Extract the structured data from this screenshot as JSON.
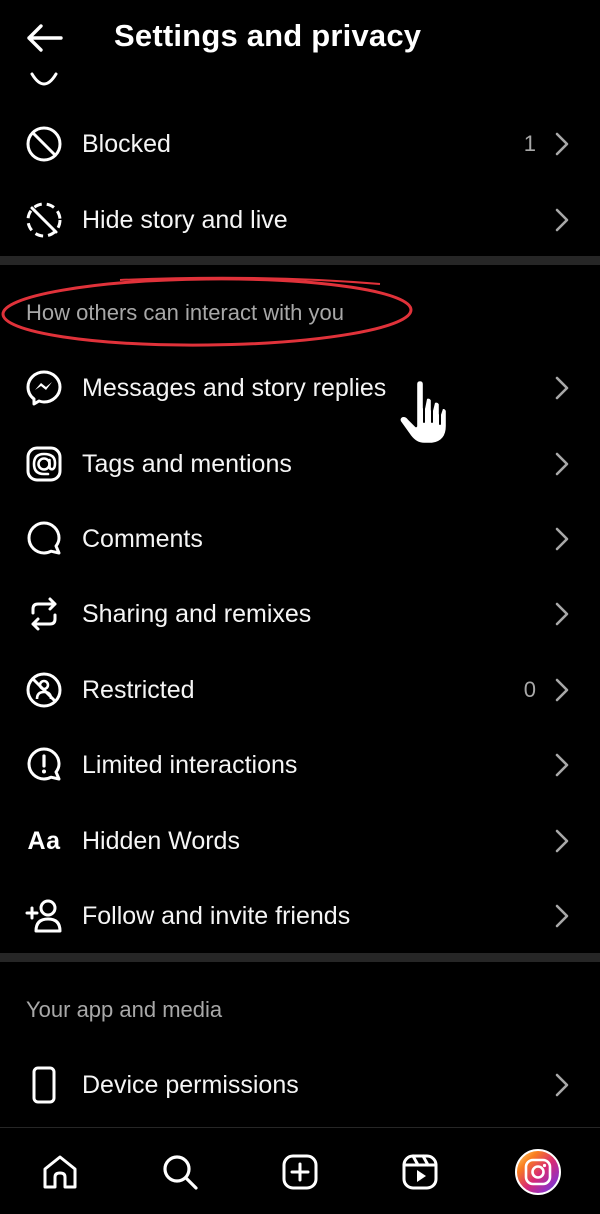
{
  "header": {
    "title": "Settings and privacy"
  },
  "rows_top": [
    {
      "label": "Blocked",
      "count": "1",
      "icon": "blocked-icon"
    },
    {
      "label": "Hide story and live",
      "count": "",
      "icon": "hide-story-icon"
    }
  ],
  "section_interact": {
    "title": "How others can interact with you",
    "items": [
      {
        "label": "Messages and story replies",
        "count": "",
        "icon": "messenger-icon"
      },
      {
        "label": "Tags and mentions",
        "count": "",
        "icon": "at-sign-icon"
      },
      {
        "label": "Comments",
        "count": "",
        "icon": "comment-icon"
      },
      {
        "label": "Sharing and remixes",
        "count": "",
        "icon": "share-remix-icon"
      },
      {
        "label": "Restricted",
        "count": "0",
        "icon": "restricted-icon"
      },
      {
        "label": "Limited interactions",
        "count": "",
        "icon": "limited-interactions-icon"
      },
      {
        "label": "Hidden Words",
        "count": "",
        "icon": "hidden-words-icon",
        "glyph": "Aa"
      },
      {
        "label": "Follow and invite friends",
        "count": "",
        "icon": "add-person-icon"
      }
    ]
  },
  "section_app": {
    "title": "Your app and media",
    "items": [
      {
        "label": "Device permissions",
        "count": "",
        "icon": "phone-icon"
      }
    ]
  },
  "nav": [
    "home-icon",
    "search-icon",
    "create-icon",
    "reels-icon",
    "profile-avatar"
  ],
  "colors": {
    "background": "#000000",
    "text": "#f5f5f5",
    "muted": "#a8a8a8",
    "divider": "#262626",
    "annotation": "#e0323a"
  }
}
